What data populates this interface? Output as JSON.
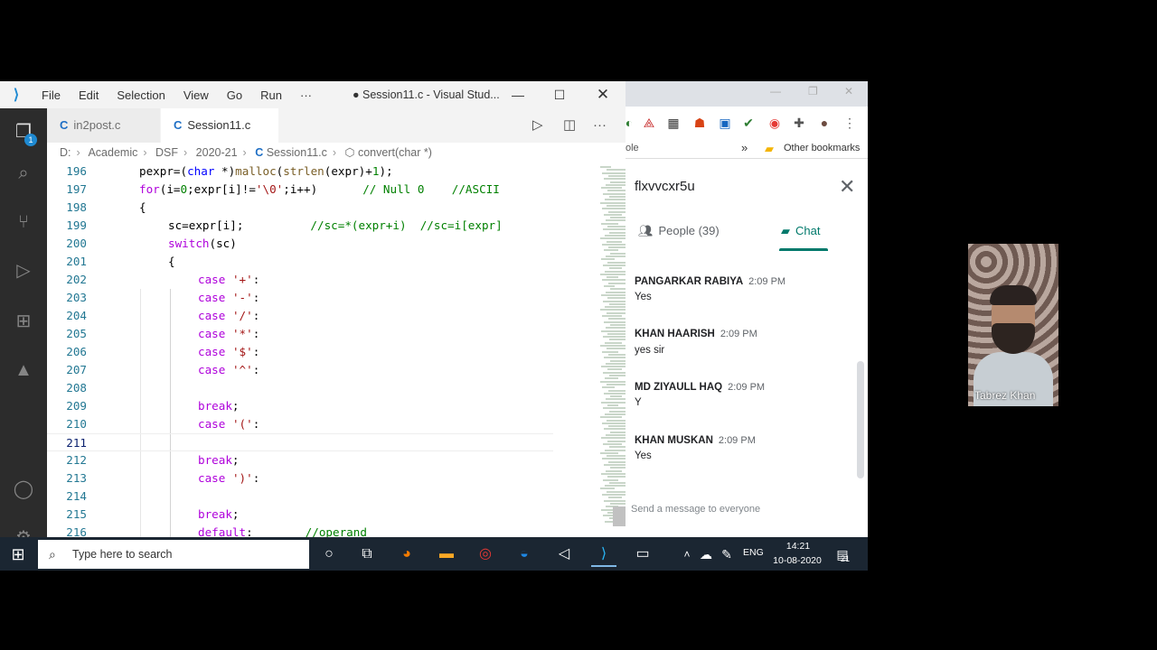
{
  "vscode": {
    "menu": [
      "File",
      "Edit",
      "Selection",
      "View",
      "Go",
      "Run",
      "···"
    ],
    "window_title": "● Session11.c - Visual Stud...",
    "tabs": [
      {
        "label": "in2post.c",
        "icon": "C"
      },
      {
        "label": "Session11.c",
        "icon": "C",
        "dirty": "●"
      }
    ],
    "breadcrumb": {
      "drive": "D:",
      "folder1": "Academic",
      "folder2": "DSF",
      "folder3": "2020-21",
      "file_icon": "C",
      "file": "Session11.c",
      "symbol": "convert(char *)"
    },
    "explorer_badge": "1"
  },
  "code_lines": [
    {
      "n": "196"
    },
    {
      "n": "197"
    },
    {
      "n": "198"
    },
    {
      "n": "199"
    },
    {
      "n": "200"
    },
    {
      "n": "201"
    },
    {
      "n": "202"
    },
    {
      "n": "203"
    },
    {
      "n": "204"
    },
    {
      "n": "205"
    },
    {
      "n": "206"
    },
    {
      "n": "207"
    },
    {
      "n": "208"
    },
    {
      "n": "209"
    },
    {
      "n": "210"
    },
    {
      "n": "211"
    },
    {
      "n": "212"
    },
    {
      "n": "213"
    },
    {
      "n": "214"
    },
    {
      "n": "215"
    },
    {
      "n": "216"
    }
  ],
  "code_text": {
    "l196_a": "pexpr=(",
    "l196_b": "char",
    "l196_c": " *)",
    "l196_d": "malloc",
    "l196_e": "(",
    "l196_f": "strlen",
    "l196_g": "(expr)+",
    "l196_h": "1",
    "l196_i": ");",
    "l197_a": "for",
    "l197_b": "(i=",
    "l197_c": "0",
    "l197_d": ";expr[i]!=",
    "l197_e": "'\\0'",
    "l197_f": ";i++)",
    "l197_g": "// Null 0    //ASCII",
    "l198": "{",
    "l199_a": "sc=expr[i];",
    "l199_b": "//sc=*(expr+i)  //sc=i[expr]",
    "l200_a": "switch",
    "l200_b": "(sc)",
    "l201": "{",
    "case": "case",
    "l202": "'+'",
    "l203": "'-'",
    "l204": "'/'",
    "l205": "'*'",
    "l206": "'$'",
    "l207": "'^'",
    "colon": ":",
    "break": "break",
    "semi": ";",
    "l210": "'('",
    "l213": "')'",
    "default": "default",
    "l216_cm": "//operand"
  },
  "meet": {
    "bookmark_more": "»",
    "bookmarks_label": "Other bookmarks",
    "bookmark_left": "ole",
    "meeting_code": "flxvvcxr5u",
    "people_tab": "People (39)",
    "chat_tab": "Chat",
    "messages": [
      {
        "name": "PANGARKAR RABIYA",
        "time": "2:09 PM",
        "text": "Yes"
      },
      {
        "name": "KHAN HAARISH",
        "time": "2:09 PM",
        "text": "yes sir"
      },
      {
        "name": "MD ZIYAULL HAQ",
        "time": "2:09 PM",
        "text": "Y"
      },
      {
        "name": "KHAN MUSKAN",
        "time": "2:09 PM",
        "text": "Yes"
      }
    ],
    "send_placeholder": "Send a message to everyone"
  },
  "video": {
    "name": "Tabrez Khan"
  },
  "taskbar": {
    "search_placeholder": "Type here to search",
    "lang": "ENG",
    "time": "14:21",
    "date": "10-08-2020",
    "notifications": "21"
  },
  "colors": {
    "accent": "#1f8ad2",
    "meet_accent": "#00796b",
    "taskbar": "#1b2632"
  }
}
